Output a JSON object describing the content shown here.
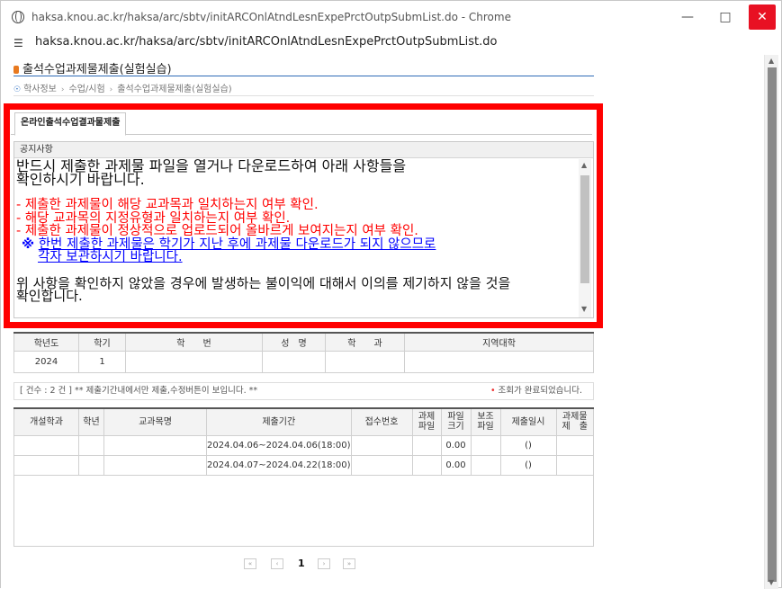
{
  "window": {
    "title": "haksa.knou.ac.kr/haksa/arc/sbtv/initARCOnlAtndLesnExpePrctOutpSubmList.do - Chrome",
    "url": "haksa.knou.ac.kr/haksa/arc/sbtv/initARCOnlAtndLesnExpePrctOutpSubmList.do"
  },
  "page": {
    "title": "출석수업과제물제출(실험실습)",
    "breadcrumb": [
      "학사정보",
      "수업/시험",
      "출석수업과제물제출(실험실습)"
    ]
  },
  "tab": {
    "label": "온라인출석수업결과물제출"
  },
  "notice": {
    "header": "공지사항",
    "line1": "반드시 제출한 과제물 파일을 열거나 다운로드하여 아래 사항들을",
    "line2": "확인하시기 바랍니다.",
    "red1": "- 제출한 과제물이 해당 교과목과 일치하는지 여부 확인.",
    "red2": "- 해당 교과목의 지정유형과 일치하는지 여부 확인.",
    "red3": "- 제출한 과제물이 정상적으로 업로드되어 올바르게 보여지는지 여부 확인.",
    "blue_mark": "※",
    "blue1": "한번 제출한 과제물은 학기가 지난 후에 과제물 다운로드가 되지 않으므로",
    "blue2": "각자 보관하시기 바랍니다.",
    "last1": "위 사항을 확인하지 않았을 경우에 발생하는 불이익에 대해서 이의를 제기하지 않을 것을",
    "last2": "확인합니다."
  },
  "info_table": {
    "headers": [
      "학년도",
      "학기",
      "학　　번",
      "성　명",
      "학　　과",
      "지역대학"
    ],
    "row": [
      "2024",
      "1",
      "",
      "",
      "",
      ""
    ]
  },
  "count_bar": {
    "left": "[ 건수 : 2 건 ] ** 제출기간내에서만 제출,수정버튼이 보입니다. **",
    "right": "조회가 완료되었습니다."
  },
  "list_table": {
    "headers": [
      "개설학과",
      "학년",
      "교과목명",
      "제출기간",
      "접수번호",
      "과제\n파일",
      "파일\n크기",
      "보조\n파일",
      "제출일시",
      "과제물\n제　출"
    ],
    "rows": [
      [
        "",
        "",
        "",
        "2024.04.06~2024.04.06(18:00)",
        "",
        "",
        "0.00",
        "",
        "()",
        ""
      ],
      [
        "",
        "",
        "",
        "2024.04.07~2024.04.22(18:00)",
        "",
        "",
        "0.00",
        "",
        "()",
        ""
      ]
    ]
  },
  "pager": {
    "current": "1"
  }
}
